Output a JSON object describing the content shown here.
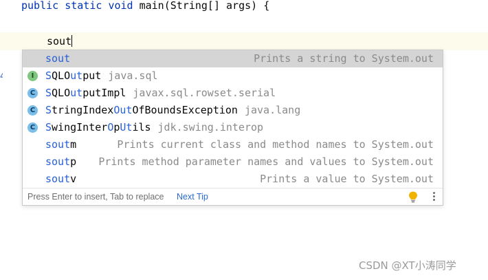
{
  "editor": {
    "line1": {
      "kw1": "public",
      "kw2": "static",
      "kw3": "void",
      "rest": "main(String[] args) {"
    },
    "typed_text": "sout",
    "gutter_marker": "4"
  },
  "completion": {
    "items": [
      {
        "match": "sout",
        "rest": "",
        "package": "",
        "description": "Prints a string to System.out",
        "icon": "",
        "selected": true
      },
      {
        "name_parts": [
          "S",
          "QLO",
          "ut",
          "put"
        ],
        "package": "java.sql",
        "icon_letter": "I",
        "icon": "interface-icon"
      },
      {
        "name_parts": [
          "S",
          "QLO",
          "ut",
          "putImpl"
        ],
        "package": "javax.sql.rowset.serial",
        "icon_letter": "C",
        "icon": "class-icon"
      },
      {
        "name_parts": [
          "S",
          "tringIndex",
          "O",
          "ut",
          "OfBoundsException"
        ],
        "package": "java.lang",
        "icon_letter": "C",
        "icon": "class-icon"
      },
      {
        "name_parts": [
          "S",
          "wingInter",
          "O",
          "p",
          "U",
          "t",
          "ils"
        ],
        "package": "jdk.swing.interop",
        "icon_letter": "C",
        "icon": "class-icon"
      },
      {
        "match": "sout",
        "rest": "m",
        "description": "Prints current class and method names to System.out"
      },
      {
        "match": "sout",
        "rest": "p",
        "description": "Prints method parameter names and values to System.out"
      },
      {
        "match": "sout",
        "rest": "v",
        "description": "Prints a value to System.out"
      }
    ],
    "footer": {
      "hint": "Press Enter to insert, Tab to replace",
      "next_tip": "Next Tip"
    }
  },
  "watermark": "CSDN @XT小涛同学",
  "colors": {
    "keyword": "#0033b3",
    "match_highlight": "#2860d6",
    "selected_row": "#d5d5d5",
    "current_line": "#fdfbeb",
    "bulb": "#f0b400"
  }
}
